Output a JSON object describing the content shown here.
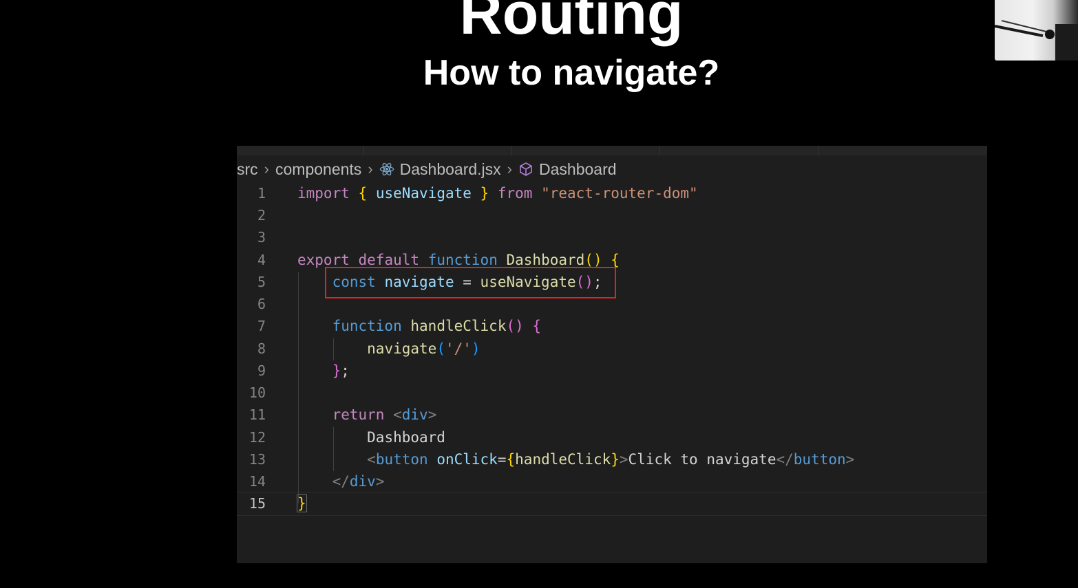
{
  "slide": {
    "title": "Routing",
    "subtitle": "How to navigate?"
  },
  "editor": {
    "breadcrumb": {
      "folder_1": "src",
      "folder_2": "components",
      "file": "Dashboard.jsx",
      "symbol": "Dashboard",
      "file_icon": "react-icon",
      "symbol_icon": "cube-icon"
    },
    "line_numbers": [
      "1",
      "2",
      "3",
      "4",
      "5",
      "6",
      "7",
      "8",
      "9",
      "10",
      "11",
      "12",
      "13",
      "14",
      "15"
    ],
    "active_line": "15",
    "code": {
      "l1": {
        "import": "import",
        "open": "{",
        "name": " useNavigate ",
        "close": "}",
        "from": "from",
        "module": "\"react-router-dom\""
      },
      "l4": {
        "export": "export",
        "default": "default",
        "function": "function",
        "name": "Dashboard",
        "parens": "()",
        "brace": "{"
      },
      "l5": {
        "const": "const",
        "var": "navigate",
        "eq": " = ",
        "call": "useNavigate",
        "parens": "()",
        "semi": ";"
      },
      "l7": {
        "function": "function",
        "name": "handleClick",
        "parens": "()",
        "brace": "{"
      },
      "l8": {
        "call": "navigate",
        "open": "(",
        "arg": "'/'",
        "close": ")"
      },
      "l9": {
        "brace": "}",
        "semi": ";"
      },
      "l11": {
        "return": "return",
        "lt": "<",
        "tag": "div",
        "gt": ">"
      },
      "l12": {
        "text": "Dashboard"
      },
      "l13": {
        "lt": "<",
        "tag": "button",
        "attr": "onClick",
        "eq": "=",
        "open": "{",
        "handler": "handleClick",
        "close": "}",
        "gt": ">",
        "text": "Click to navigate",
        "end_lt": "</",
        "end_tag": "button",
        "end_gt": ">"
      },
      "l14": {
        "lt": "</",
        "tag": "div",
        "gt": ">"
      },
      "l15": {
        "brace": "}"
      }
    }
  },
  "colors": {
    "highlight_box": "#e0231f",
    "editor_background": "#1e1e1e"
  }
}
